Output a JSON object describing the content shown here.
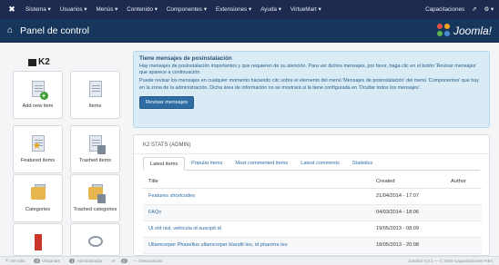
{
  "topbar": {
    "menu": [
      "Sistema ▾",
      "Usuarios ▾",
      "Menús ▾",
      "Contenido ▾",
      "Componentes ▾",
      "Extensiones ▾",
      "Ayuda ▾",
      "VirtueMart ▾"
    ],
    "site_name": "Capacitaciones",
    "colors": {
      "bar": "#1e2a4f"
    }
  },
  "header": {
    "title": "Panel de control",
    "logo_text": "Joomla!"
  },
  "sidebar": {
    "k2_label": "K2",
    "tiles": [
      "Add new item",
      "Items",
      "Featured items",
      "Trashed items",
      "Categories",
      "Trashed categories",
      "",
      ""
    ]
  },
  "alert": {
    "title": "Tiene mensajes de posinstalación",
    "paragraph1": "Hay mensajes de posinstalación importantes y que requieren de su atención. Para ver dichos mensajes, por favor, haga clic en el botón 'Revisar mensajes' que aparece a continuación.",
    "paragraph2": "Puede revisar los mensajes en cualquier momento haciendo clic sobre el elemento del menú 'Mensajes de posinstalación' del menú 'Componentes' que hay en la zona de la administración. Dicha área de información no se mostrará si la tiene configurada en 'Ocultar todos los mensajes'.",
    "button": "Revisar mensajes"
  },
  "panel": {
    "title": "K2 STATS (ADMIN)",
    "tabs": [
      "Latest items",
      "Popular items",
      "Most commented items",
      "Latest comments",
      "Statistics"
    ],
    "columns": {
      "title": "Title",
      "created": "Created",
      "author": "Author"
    },
    "rows": [
      {
        "title": "Features shortcodes",
        "created": "21/04/2014 - 17:07",
        "author": ""
      },
      {
        "title": "FAQs",
        "created": "04/03/2014 - 18:06",
        "author": ""
      },
      {
        "title": "Ut elit nisl, vehicula id suscipit id",
        "created": "19/05/2013 - 08:09",
        "author": ""
      },
      {
        "title": "Ullamcorper Phasellus ullamcorper blandit leo, id pharetra leo",
        "created": "18/05/2013 - 20:08",
        "author": ""
      }
    ]
  },
  "footer": {
    "view_site": "Ver sitio",
    "visitors_count": "0",
    "visitors_label": "Visitantes",
    "admin_count": "1",
    "admin_label": "Administrador",
    "messages_count": "0",
    "logout": "Desconectar",
    "version": "Joomla! 3.3.1 — © 2015 Capacitaciones FIEC"
  }
}
